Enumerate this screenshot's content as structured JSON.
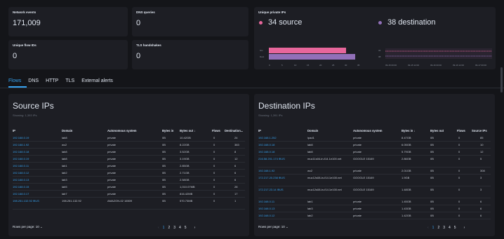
{
  "stats": {
    "network_events": {
      "label": "Network events",
      "value": "171,009"
    },
    "dns_queries": {
      "label": "DNS queries",
      "value": "0"
    },
    "unique_flow_ids": {
      "label": "Unique flow IDs",
      "value": "0"
    },
    "tls_handshakes": {
      "label": "TLS handshakes",
      "value": "0"
    }
  },
  "unique_private_ips": {
    "label": "Unique private IPs",
    "source": "34 source",
    "destination": "38 destination",
    "colors": {
      "source": "#e7669b",
      "destination": "#9170b8"
    },
    "bar_chart": {
      "ylabels": [
        "Src",
        "Dest"
      ],
      "xticks": [
        "0",
        "5",
        "10",
        "15",
        "20",
        "25",
        "30",
        "35"
      ],
      "values": [
        30,
        34
      ]
    },
    "timeline": {
      "ylabels": [
        "34",
        "38"
      ],
      "xticks": [
        "09-15 00:00",
        "09-15 12:00",
        "09-16 00:00",
        "09-16 12:00",
        "09-17 00:00"
      ]
    }
  },
  "tabs": [
    "Flows",
    "DNS",
    "HTTP",
    "TLS",
    "External alerts"
  ],
  "source_ips": {
    "title": "Source IPs",
    "showing": "Showing: 1,393 IPs",
    "headers": [
      "IP",
      "Domain",
      "Autonomous system",
      "Bytes in",
      "Bytes out ↓",
      "Flows",
      "Destination..."
    ],
    "rows": [
      [
        "192.168.0.19",
        "lab8",
        "private",
        "0B",
        "10.42GB",
        "0",
        "24"
      ],
      [
        "192.168.1.92",
        "wc2",
        "private",
        "0B",
        "8.22GB",
        "0",
        "383"
      ],
      [
        "192.168.0.18",
        "lab8",
        "private",
        "0B",
        "3.52GB",
        "0",
        "8"
      ],
      [
        "192.168.0.19",
        "lab8",
        "private",
        "0B",
        "3.19GB",
        "0",
        "12"
      ],
      [
        "192.168.0.11",
        "lab1",
        "private",
        "0B",
        "2.85GB",
        "0",
        "6"
      ],
      [
        "192.168.0.12",
        "lab2",
        "private",
        "0B",
        "2.71GB",
        "0",
        "6"
      ],
      [
        "192.168.0.13",
        "lab3",
        "private",
        "0B",
        "2.58GB",
        "0",
        "6"
      ],
      [
        "192.168.0.15",
        "lab5",
        "private",
        "0B",
        "1,010.07MB",
        "0",
        "28"
      ],
      [
        "192.168.0.17",
        "lab7",
        "private",
        "0B",
        "816.42MB",
        "0",
        "17"
      ],
      [
        "198.251.132.92 ⊕US",
        "198.251.132.92",
        "AMAZON-02 16509",
        "0B",
        "570.73MB",
        "0",
        "1"
      ]
    ],
    "rows_per_page": "Rows per page: 10",
    "pages": [
      "1",
      "2",
      "3",
      "4",
      "5"
    ]
  },
  "destination_ips": {
    "title": "Destination IPs",
    "showing": "Showing: 1,391 IPs",
    "headers": [
      "IP",
      "Domain",
      "Autonomous system",
      "Bytes in ↓",
      "Bytes out",
      "Flows",
      "Source IPs"
    ],
    "rows": [
      [
        "192.168.1.252",
        "ipad1",
        "private",
        "8.47GB",
        "0B",
        "0",
        "85"
      ],
      [
        "192.168.0.18",
        "lab8",
        "private",
        "6.05GB",
        "0B",
        "0",
        "10"
      ],
      [
        "192.168.0.18",
        "lab8",
        "private",
        "5.79GB",
        "0B",
        "0",
        "12"
      ],
      [
        "216.58.201.174 ⊕US",
        "muc11s04-in-f14.1e100.net",
        "GOOGLE 15169",
        "2.86GB",
        "0B",
        "0",
        "5"
      ],
      [
        "192.168.1.92",
        "wc2",
        "private",
        "2.01GB",
        "0B",
        "0",
        "308"
      ],
      [
        "172.217.20.238 ⊕US",
        "muc12s08-in-f14.1e100.net",
        "GOOGLE 15169",
        "1.9GB",
        "0B",
        "0",
        "3"
      ],
      [
        "172.217.23.14 ⊕US",
        "muc12s08-in-f14.1e100.net",
        "GOOGLE 15169",
        "1.48GB",
        "0B",
        "0",
        "3"
      ],
      [
        "192.168.0.11",
        "lab1",
        "private",
        "1.45GB",
        "0B",
        "0",
        "6"
      ],
      [
        "192.168.0.13",
        "lab3",
        "private",
        "1.43GB",
        "0B",
        "0",
        "6"
      ],
      [
        "192.168.0.12",
        "lab2",
        "private",
        "1.42GB",
        "0B",
        "0",
        "6"
      ]
    ],
    "rows_per_page": "Rows per page: 10",
    "pages": [
      "1",
      "2",
      "3",
      "4",
      "5"
    ]
  }
}
